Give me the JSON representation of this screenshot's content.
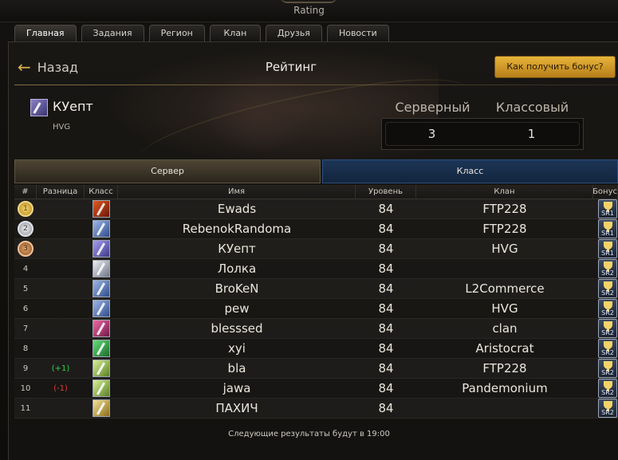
{
  "window": {
    "title": "Rating"
  },
  "tabs": [
    {
      "label": "Главная"
    },
    {
      "label": "Задания"
    },
    {
      "label": "Регион"
    },
    {
      "label": "Клан"
    },
    {
      "label": "Друзья"
    },
    {
      "label": "Новости"
    }
  ],
  "header": {
    "back_label": "Назад",
    "title": "Рейтинг",
    "bonus_button": "Как получить бонус?"
  },
  "player": {
    "name": "КУепт",
    "clan": "HVG"
  },
  "ranking": {
    "server_label": "Серверный",
    "class_label": "Классовый",
    "server_value": "3",
    "class_value": "1"
  },
  "subtabs": {
    "server": "Сервер",
    "class": "Класс"
  },
  "table": {
    "columns": [
      "#",
      "Разница",
      "Класс",
      "Имя",
      "Уровень",
      "Клан",
      "Бонус"
    ],
    "rows": [
      {
        "rank": "1",
        "diff": "",
        "name": "Ewads",
        "level": "84",
        "clan": "FTP228",
        "bonus": "SR1"
      },
      {
        "rank": "2",
        "diff": "",
        "name": "RebenokRandoma",
        "level": "84",
        "clan": "FTP228",
        "bonus": "SR1"
      },
      {
        "rank": "3",
        "diff": "",
        "name": "КУепт",
        "level": "84",
        "clan": "HVG",
        "bonus": "SR1"
      },
      {
        "rank": "4",
        "diff": "",
        "name": "Лолка",
        "level": "84",
        "clan": "",
        "bonus": "SR2"
      },
      {
        "rank": "5",
        "diff": "",
        "name": "BroKeN",
        "level": "84",
        "clan": "L2Commerce",
        "bonus": "SR2"
      },
      {
        "rank": "6",
        "diff": "",
        "name": "pew",
        "level": "84",
        "clan": "HVG",
        "bonus": "SR2"
      },
      {
        "rank": "7",
        "diff": "",
        "name": "blesssed",
        "level": "84",
        "clan": "clan",
        "bonus": "SR2"
      },
      {
        "rank": "8",
        "diff": "",
        "name": "xyi",
        "level": "84",
        "clan": "Aristocrat",
        "bonus": "SR2"
      },
      {
        "rank": "9",
        "diff": "(+1)",
        "name": "bla",
        "level": "84",
        "clan": "FTP228",
        "bonus": "SR2"
      },
      {
        "rank": "10",
        "diff": "(-1)",
        "name": "jawa",
        "level": "84",
        "clan": "Pandemonium",
        "bonus": "SR2"
      },
      {
        "rank": "11",
        "diff": "",
        "name": "ПАХИЧ",
        "level": "84",
        "clan": "",
        "bonus": "SR2"
      }
    ]
  },
  "footer": {
    "text": "Следующие результаты будут в 19:00"
  },
  "colors": {
    "accent_gold": "#d8b34a",
    "diff_up": "#2fd24a",
    "diff_down": "#e03a3a",
    "server_tab": "#4f4534",
    "class_tab": "#1d3556"
  }
}
